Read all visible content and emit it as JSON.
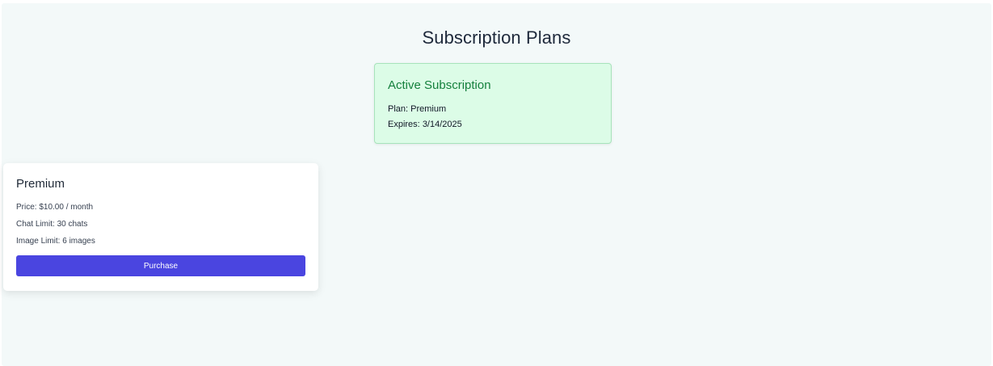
{
  "page": {
    "title": "Subscription Plans"
  },
  "active_subscription": {
    "heading": "Active Subscription",
    "plan_label": "Plan:",
    "plan_value": "Premium",
    "expires_label": "Expires:",
    "expires_value": "3/14/2025"
  },
  "plans": [
    {
      "name": "Premium",
      "price": "Price: $10.00 / month",
      "chat_limit": "Chat Limit: 30 chats",
      "image_limit": "Image Limit: 6 images",
      "button_label": "Purchase"
    }
  ],
  "colors": {
    "accent": "#4a45e0",
    "active_bg": "#dcfce7",
    "active_text": "#15803d",
    "page_bg": "#f3f9f9"
  }
}
